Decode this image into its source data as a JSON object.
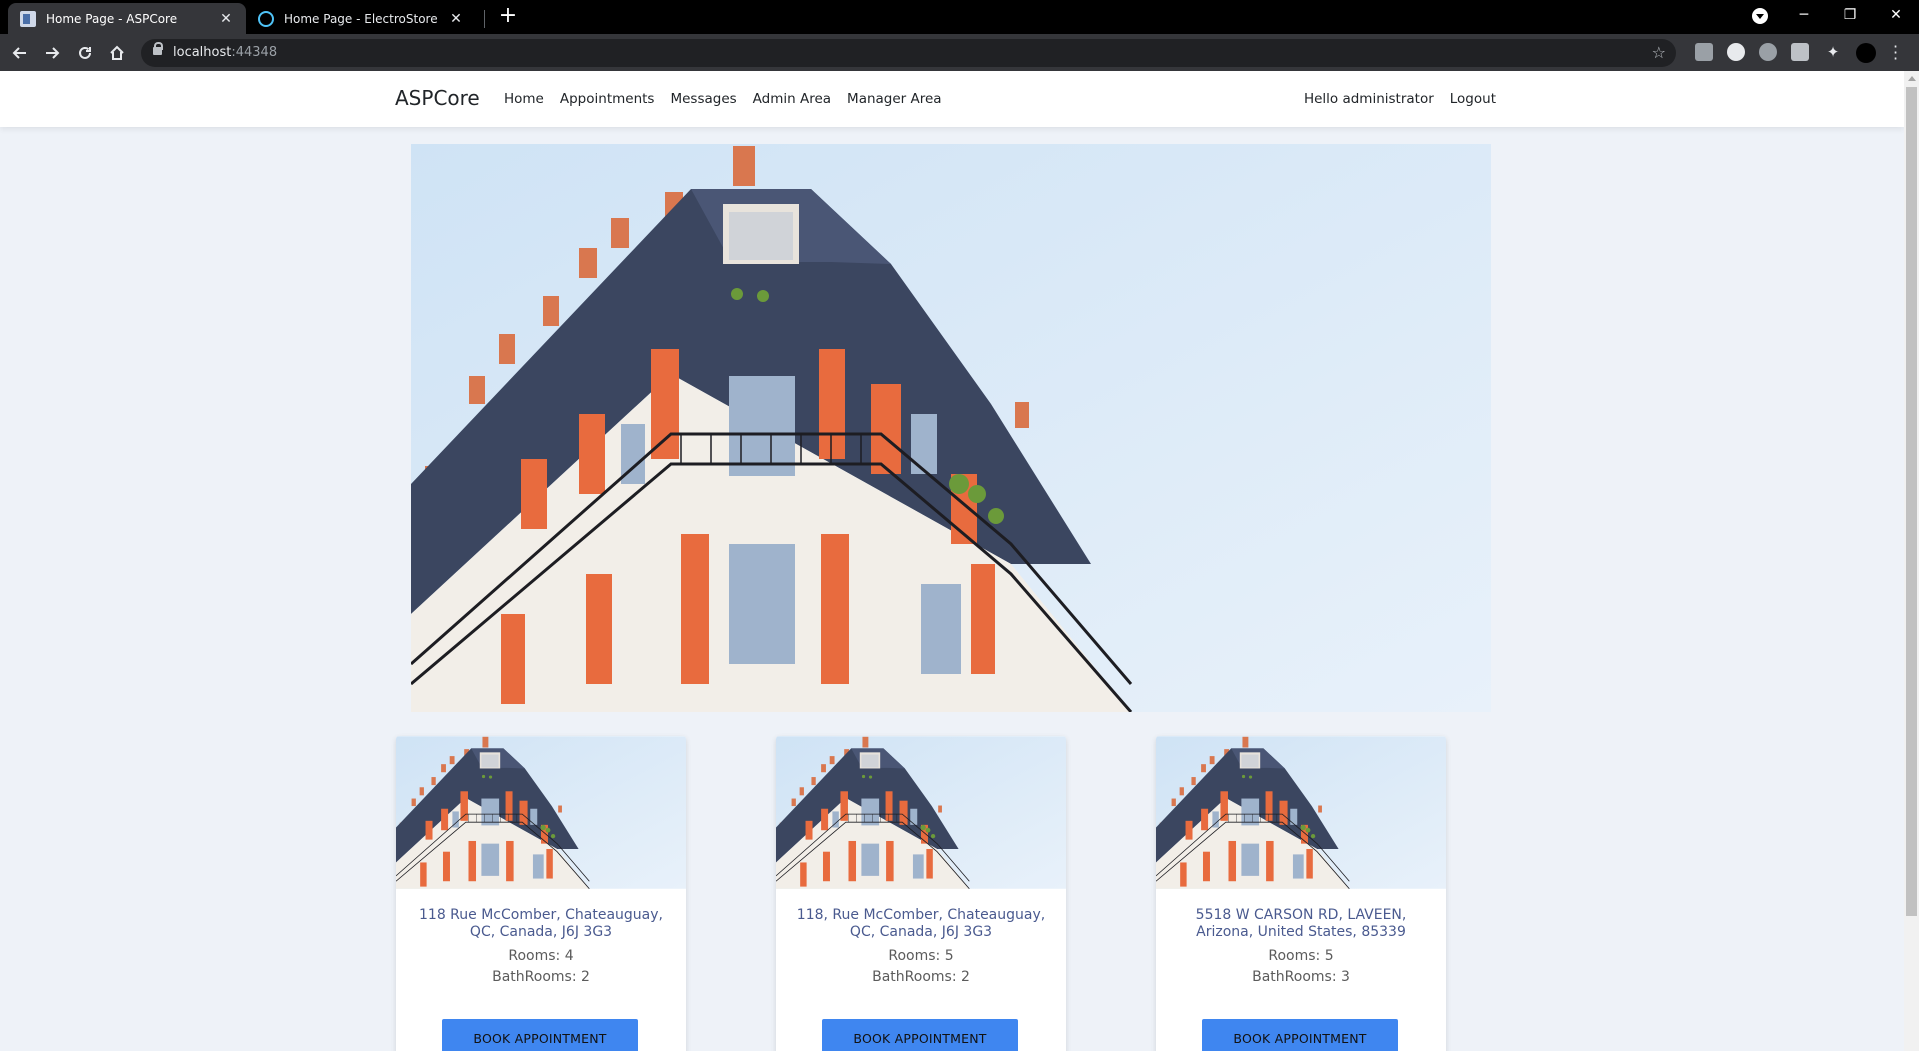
{
  "browser": {
    "tabs": [
      {
        "title": "Home Page - ASPCore",
        "active": true
      },
      {
        "title": "Home Page - ElectroStore",
        "active": false
      }
    ],
    "url_host": "localhost",
    "url_port": ":44348"
  },
  "navbar": {
    "brand": "ASPCore",
    "links": [
      "Home",
      "Appointments",
      "Messages",
      "Admin Area",
      "Manager Area"
    ],
    "greeting": "Hello administrator",
    "logout": "Logout"
  },
  "properties": [
    {
      "address": "118 Rue McComber, Chateauguay, QC, Canada, J6J 3G3",
      "rooms": "Rooms: 4",
      "bathrooms": "BathRooms: 2",
      "button": "BOOK APPOINTMENT"
    },
    {
      "address": "118, Rue McComber, Chateauguay, QC, Canada, J6J 3G3",
      "rooms": "Rooms: 5",
      "bathrooms": "BathRooms: 2",
      "button": "BOOK APPOINTMENT"
    },
    {
      "address": "5518 W CARSON RD, LAVEEN, Arizona, United States, 85339",
      "rooms": "Rooms: 5",
      "bathrooms": "BathRooms: 3",
      "button": "BOOK APPOINTMENT"
    }
  ],
  "colors": {
    "page_bg": "#eef2f8",
    "button": "#3f86f0",
    "address_text": "#4a5a8f"
  }
}
